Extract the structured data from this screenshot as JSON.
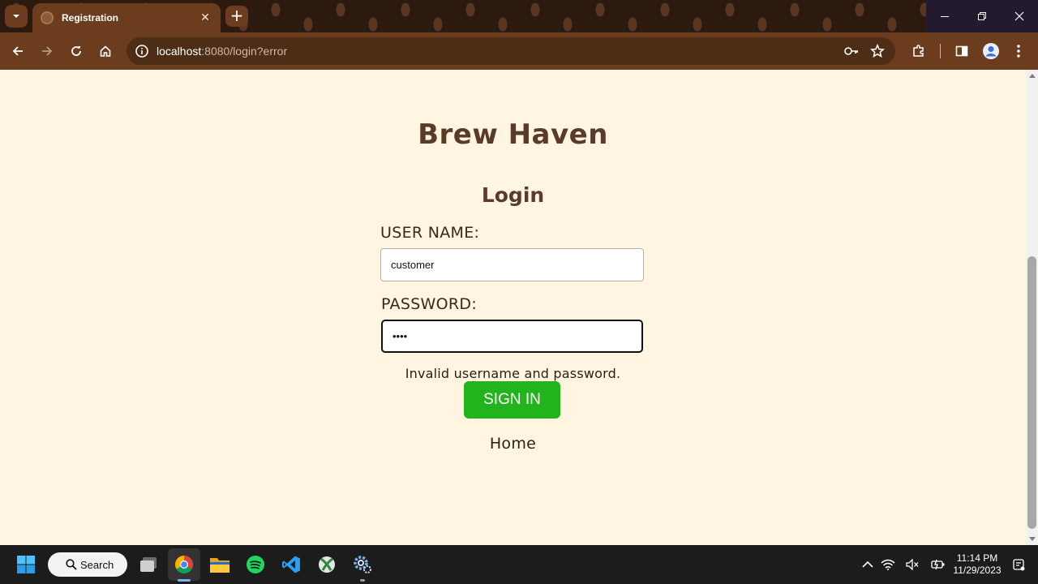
{
  "browser": {
    "tab_title": "Registration",
    "url_host": "localhost",
    "url_path": ":8080/login?error"
  },
  "page": {
    "site_title": "Brew Haven",
    "form_title": "Login",
    "username_label": "USER NAME:",
    "username_value": "customer",
    "password_label": "PASSWORD:",
    "password_value": "••••",
    "error_message": "Invalid username and password.",
    "signin_label": "SIGN IN",
    "home_link": "Home"
  },
  "taskbar": {
    "search_label": "Search",
    "time": "11:14 PM",
    "date": "11/29/2023"
  },
  "colors": {
    "page_bg": "#fff5e1",
    "title_brown": "#5a3a28",
    "signin_green": "#22b41c",
    "toolbar_brown": "#6b3d1e"
  }
}
